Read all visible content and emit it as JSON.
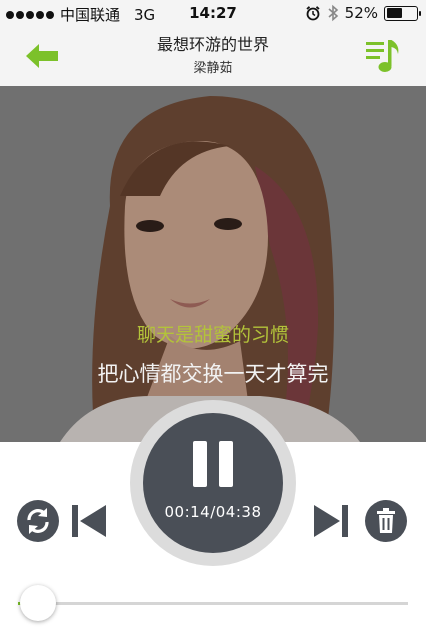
{
  "status_bar": {
    "carrier": "中国联通",
    "network": "3G",
    "time": "14:27",
    "battery_percent": "52%",
    "battery_level": 0.52,
    "icons": [
      "alarm-icon",
      "bluetooth-icon",
      "battery-icon"
    ]
  },
  "header": {
    "title": "最想环游的世界",
    "artist": "梁静茹",
    "back_icon": "arrow-left-icon",
    "playlist_icon": "playlist-music-icon"
  },
  "lyrics": {
    "current": "聊天是甜蜜的习惯",
    "next": "把心情都交换一天才算完"
  },
  "player": {
    "state_icon": "pause-icon",
    "time_display": "00:14/04:38",
    "progress": 0.05,
    "controls": [
      "repeat-icon",
      "previous-icon",
      "next-icon",
      "delete-icon"
    ]
  },
  "colors": {
    "accent": "#7cc12a",
    "lyric_highlight": "#b3c33a",
    "control_dark": "#4a4f57",
    "bar_bg": "#f4f4f4"
  }
}
